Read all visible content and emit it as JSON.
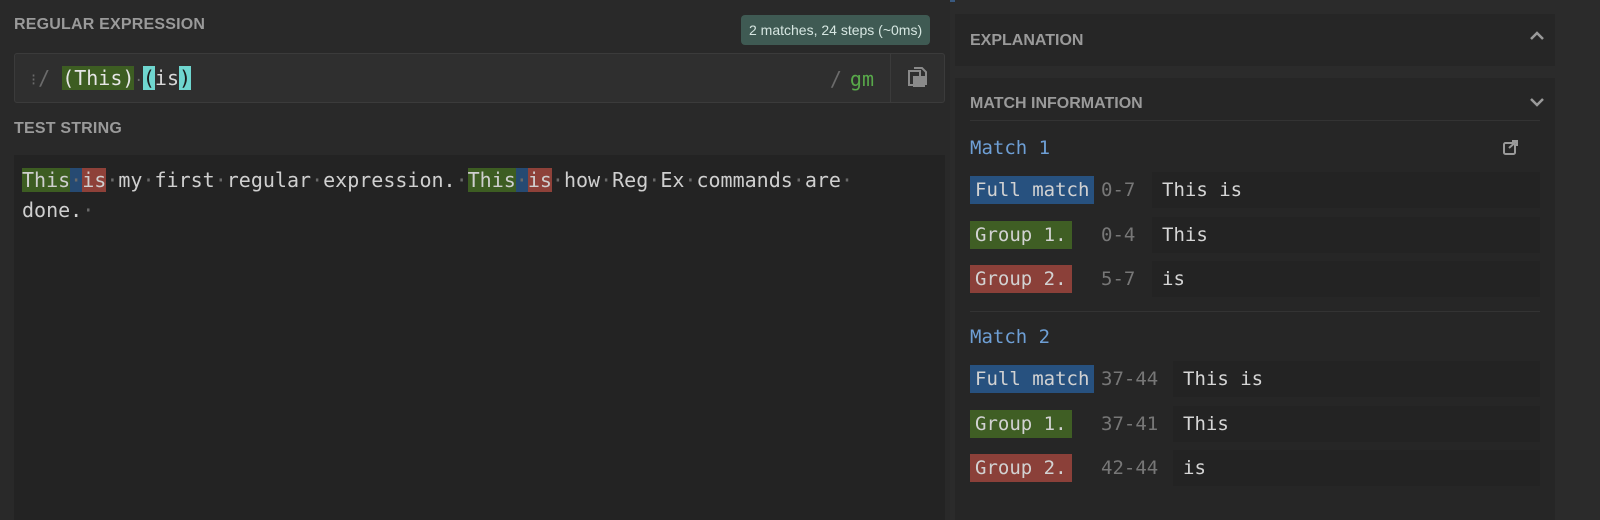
{
  "regex_section": {
    "title": "REGULAR EXPRESSION",
    "status": "2 matches, 24 steps (~0ms)",
    "delimiter": "/",
    "group1": "(This)",
    "group2_open": "(",
    "group2_body": "is",
    "group2_close": ")",
    "flags": "gm",
    "accent_color": "#58a84a"
  },
  "test_section": {
    "title": "TEST STRING",
    "line1_parts": [
      "This",
      "is",
      "my",
      "first",
      "regular",
      "expression.",
      "This",
      "is",
      "how",
      "Reg",
      "Ex",
      "commands",
      "are"
    ],
    "line2": "done."
  },
  "explanation": {
    "title": "EXPLANATION"
  },
  "match_info": {
    "title": "MATCH INFORMATION",
    "matches": [
      {
        "title": "Match 1",
        "rows": [
          {
            "label": "Full match",
            "range": "0-7",
            "value": "This is"
          },
          {
            "label": "Group 1.",
            "range": "0-4",
            "value": "This"
          },
          {
            "label": "Group 2.",
            "range": "5-7",
            "value": "is"
          }
        ]
      },
      {
        "title": "Match 2",
        "rows": [
          {
            "label": "Full match",
            "range": "37-44",
            "value": "This is"
          },
          {
            "label": "Group 1.",
            "range": "37-41",
            "value": "This"
          },
          {
            "label": "Group 2.",
            "range": "42-44",
            "value": "is"
          }
        ]
      }
    ]
  },
  "icons": [
    "drag-handle-icon",
    "copy-icon",
    "chevron-up-icon",
    "chevron-down-icon",
    "share-icon"
  ]
}
